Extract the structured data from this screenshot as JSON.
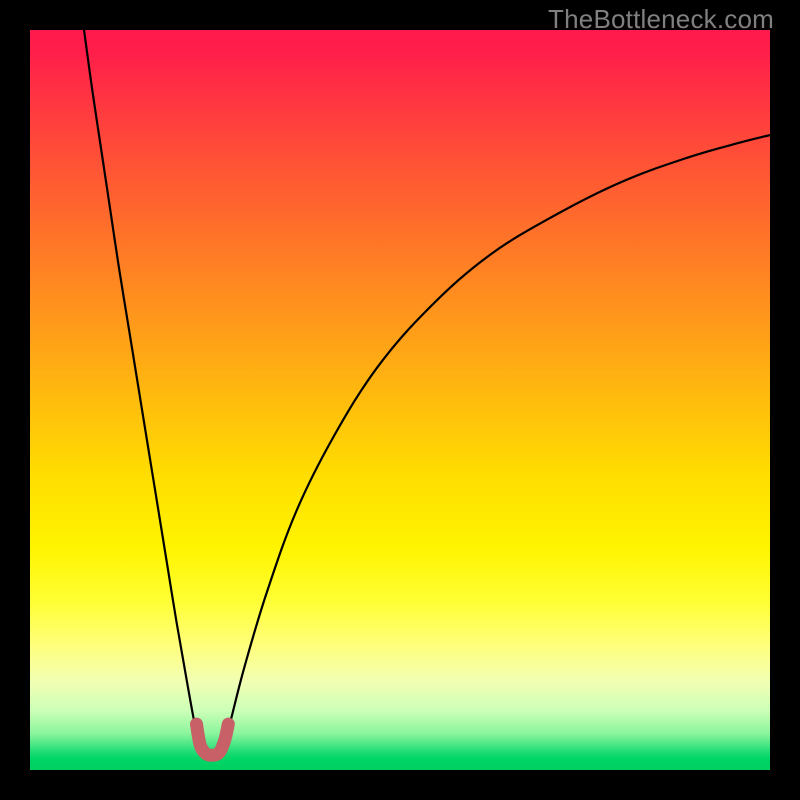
{
  "watermark": "TheBottleneck.com",
  "chart_data": {
    "type": "line",
    "title": "",
    "xlabel": "",
    "ylabel": "",
    "xlim": [
      0,
      1
    ],
    "ylim": [
      0,
      1
    ],
    "background_gradient": {
      "stops": [
        {
          "offset": 0.0,
          "color": "#ff1a4d"
        },
        {
          "offset": 0.03,
          "color": "#ff1e4a"
        },
        {
          "offset": 0.1,
          "color": "#ff3740"
        },
        {
          "offset": 0.2,
          "color": "#ff5933"
        },
        {
          "offset": 0.3,
          "color": "#ff7a26"
        },
        {
          "offset": 0.4,
          "color": "#ff9b1a"
        },
        {
          "offset": 0.5,
          "color": "#ffbc0d"
        },
        {
          "offset": 0.6,
          "color": "#ffdd00"
        },
        {
          "offset": 0.7,
          "color": "#fff400"
        },
        {
          "offset": 0.77,
          "color": "#ffff33"
        },
        {
          "offset": 0.83,
          "color": "#ffff7a"
        },
        {
          "offset": 0.88,
          "color": "#f2ffb3"
        },
        {
          "offset": 0.92,
          "color": "#ccffb8"
        },
        {
          "offset": 0.95,
          "color": "#8cf59d"
        },
        {
          "offset": 0.965,
          "color": "#4ee887"
        },
        {
          "offset": 0.975,
          "color": "#20dd75"
        },
        {
          "offset": 0.985,
          "color": "#00d666"
        },
        {
          "offset": 1.0,
          "color": "#00d060"
        }
      ]
    },
    "series": [
      {
        "name": "left-branch",
        "stroke": "#000000",
        "stroke_width": 2.2,
        "points": [
          {
            "x": 0.073,
            "y": 1.0
          },
          {
            "x": 0.084,
            "y": 0.92
          },
          {
            "x": 0.096,
            "y": 0.84
          },
          {
            "x": 0.108,
            "y": 0.76
          },
          {
            "x": 0.12,
            "y": 0.68
          },
          {
            "x": 0.133,
            "y": 0.6
          },
          {
            "x": 0.146,
            "y": 0.52
          },
          {
            "x": 0.159,
            "y": 0.44
          },
          {
            "x": 0.172,
            "y": 0.36
          },
          {
            "x": 0.185,
            "y": 0.28
          },
          {
            "x": 0.198,
            "y": 0.2
          },
          {
            "x": 0.212,
            "y": 0.12
          },
          {
            "x": 0.222,
            "y": 0.065
          },
          {
            "x": 0.228,
            "y": 0.04
          }
        ]
      },
      {
        "name": "right-branch",
        "stroke": "#000000",
        "stroke_width": 2.2,
        "points": [
          {
            "x": 0.264,
            "y": 0.04
          },
          {
            "x": 0.272,
            "y": 0.07
          },
          {
            "x": 0.29,
            "y": 0.14
          },
          {
            "x": 0.32,
            "y": 0.24
          },
          {
            "x": 0.36,
            "y": 0.35
          },
          {
            "x": 0.41,
            "y": 0.45
          },
          {
            "x": 0.47,
            "y": 0.545
          },
          {
            "x": 0.54,
            "y": 0.625
          },
          {
            "x": 0.62,
            "y": 0.695
          },
          {
            "x": 0.71,
            "y": 0.75
          },
          {
            "x": 0.8,
            "y": 0.795
          },
          {
            "x": 0.89,
            "y": 0.828
          },
          {
            "x": 0.96,
            "y": 0.848
          },
          {
            "x": 1.0,
            "y": 0.858
          }
        ]
      },
      {
        "name": "valley-highlight",
        "stroke": "#c76067",
        "stroke_width": 13,
        "linecap": "round",
        "points": [
          {
            "x": 0.225,
            "y": 0.062
          },
          {
            "x": 0.23,
            "y": 0.034
          },
          {
            "x": 0.238,
            "y": 0.022
          },
          {
            "x": 0.247,
            "y": 0.02
          },
          {
            "x": 0.256,
            "y": 0.024
          },
          {
            "x": 0.263,
            "y": 0.04
          },
          {
            "x": 0.268,
            "y": 0.062
          }
        ]
      }
    ]
  }
}
